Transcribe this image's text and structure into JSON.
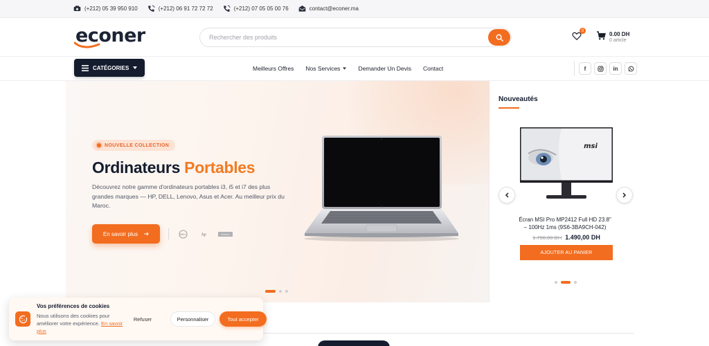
{
  "topbar": {
    "phones": [
      "(+212) 05 39 950 910",
      "(+212) 06 91 72 72 72",
      "(+212) 07 05 05 00 76"
    ],
    "email": "contact@econer.ma"
  },
  "header": {
    "logo_text": "econer",
    "search_placeholder": "Rechercher des produits",
    "wishlist_count": "0",
    "cart_total": "0.00 DH",
    "cart_count": "0 article"
  },
  "nav": {
    "categories_label": "CATÉGORIES",
    "links": [
      "Meilleurs Offres",
      "Nos Services",
      "Demander Un Devis",
      "Contact"
    ],
    "socials": [
      "facebook-icon",
      "instagram-icon",
      "linkedin-icon",
      "whatsapp-icon"
    ]
  },
  "hero": {
    "badge": "NOUVELLE COLLECTION",
    "title_main": "Ordinateurs",
    "title_accent": "Portables",
    "description": "Découvrez notre gamme d'ordinateurs portables i3, i5 et i7 des plus grandes marques — HP, DELL, Lenovo, Asus et Acer. Au meilleur prix du Maroc.",
    "cta_label": "En savoir plus",
    "brand_logos": [
      "dell-logo",
      "hp-logo",
      "lenovo-logo"
    ],
    "slide_count": 3,
    "active_slide": 1
  },
  "side": {
    "title": "Nouveautés",
    "product_name": "Écran MSI Pro MP2412 Full HD 23.8\" – 100Hz 1ms (9S6-3BA9CH-042)",
    "old_price": "1.790,00 DH",
    "new_price": "1.490,00 DH",
    "add_to_cart": "AJOUTER AU PANIER",
    "screen_brand": "msi",
    "slide_count": 3,
    "active_slide": 2
  },
  "cookie": {
    "title": "Vos préférences de cookies",
    "text": "Nous utilisons des cookies pour améliorer votre expérience.",
    "link": "En savoir plus",
    "refuse": "Refuser",
    "customize": "Personnaliser",
    "accept": "Tout accepter"
  },
  "colors": {
    "accent": "#f26d1f",
    "navy": "#141c2e"
  }
}
